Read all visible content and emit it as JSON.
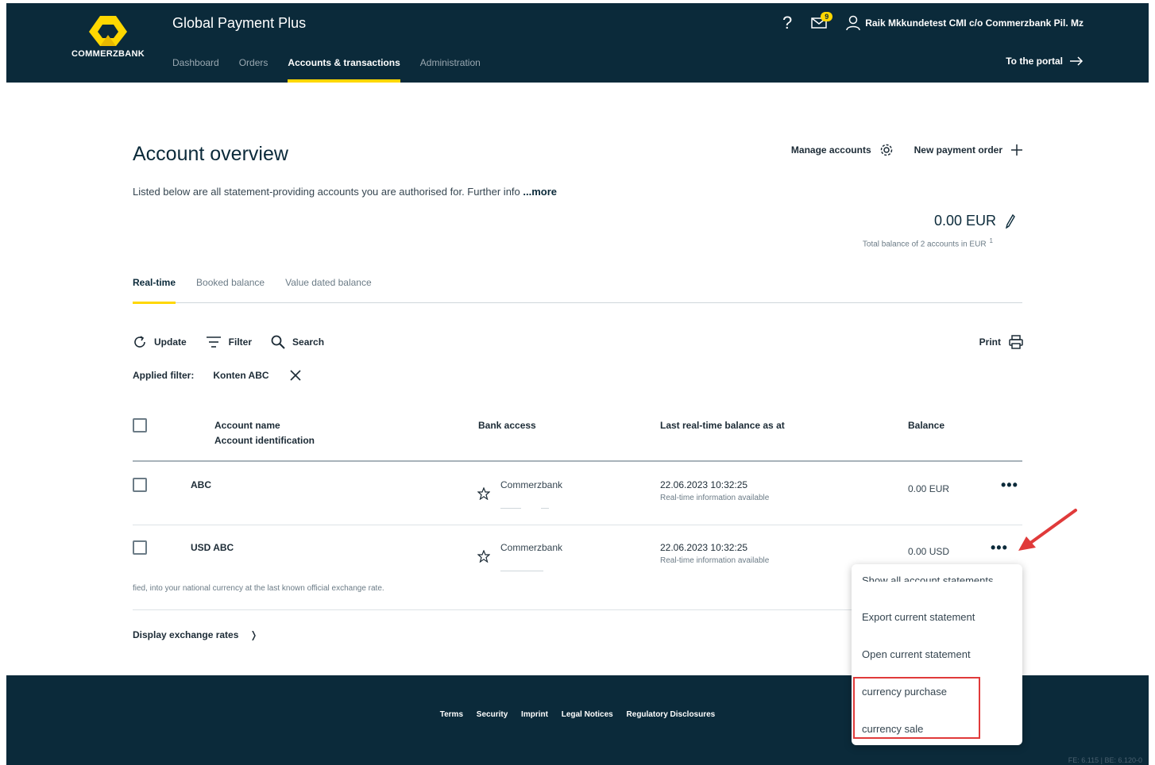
{
  "header": {
    "logo_text": "COMMERZBANK",
    "app_title": "Global Payment Plus",
    "nav": [
      {
        "label": "Dashboard",
        "active": false
      },
      {
        "label": "Orders",
        "active": false
      },
      {
        "label": "Accounts & transactions",
        "active": true
      },
      {
        "label": "Administration",
        "active": false
      }
    ],
    "help_symbol": "?",
    "mail_badge": "9",
    "user_name": "Raik Mkkundetest CMI c/o Commerzbank Pil. Mz",
    "portal_link": "To the portal"
  },
  "main": {
    "title": "Account overview",
    "manage_accounts": "Manage accounts",
    "new_payment_order": "New payment order",
    "intro_text": "Listed below are all statement-providing accounts you are authorised for. Further info",
    "intro_more": "...more",
    "total_amount": "0.00 EUR",
    "total_label": "Total balance of 2 accounts in EUR",
    "total_footnote": "1",
    "tabs": [
      {
        "label": "Real-time",
        "active": true
      },
      {
        "label": "Booked balance",
        "active": false
      },
      {
        "label": "Value dated balance",
        "active": false
      }
    ],
    "toolbar": {
      "update": "Update",
      "filter": "Filter",
      "search": "Search",
      "print": "Print"
    },
    "applied_filter_label": "Applied filter:",
    "applied_filter_value": "Konten ABC"
  },
  "table": {
    "headers": {
      "account_name": "Account name",
      "account_id": "Account identification",
      "bank_access": "Bank access",
      "last_balance": "Last real-time balance as at",
      "balance": "Balance"
    },
    "rows": [
      {
        "name": "ABC",
        "bank": "Commerzbank",
        "timestamp": "22.06.2023 10:32:25",
        "status": "Real-time information available",
        "balance": "0.00 EUR"
      },
      {
        "name": "USD ABC",
        "bank": "Commerzbank",
        "timestamp": "22.06.2023 10:32:25",
        "status": "Real-time information available",
        "balance": "0.00 USD"
      }
    ],
    "more_symbol": "•••"
  },
  "footnote": "fied, into your national currency at the last known official exchange rate.",
  "exchange_link": "Display exchange rates",
  "exchange_chevron": "❭",
  "dropdown": {
    "items": [
      "Show all account statements",
      "Export current statement",
      "Open current statement",
      "currency purchase",
      "currency sale"
    ]
  },
  "footer": {
    "links": [
      "Terms",
      "Security",
      "Imprint",
      "Legal Notices",
      "Regulatory Disclosures"
    ],
    "version": "FE: 6.115 | BE: 6.120-0"
  },
  "colors": {
    "header_bg": "#0b2a3a",
    "accent": "#ffd700",
    "annotation_red": "#e03a3a"
  }
}
